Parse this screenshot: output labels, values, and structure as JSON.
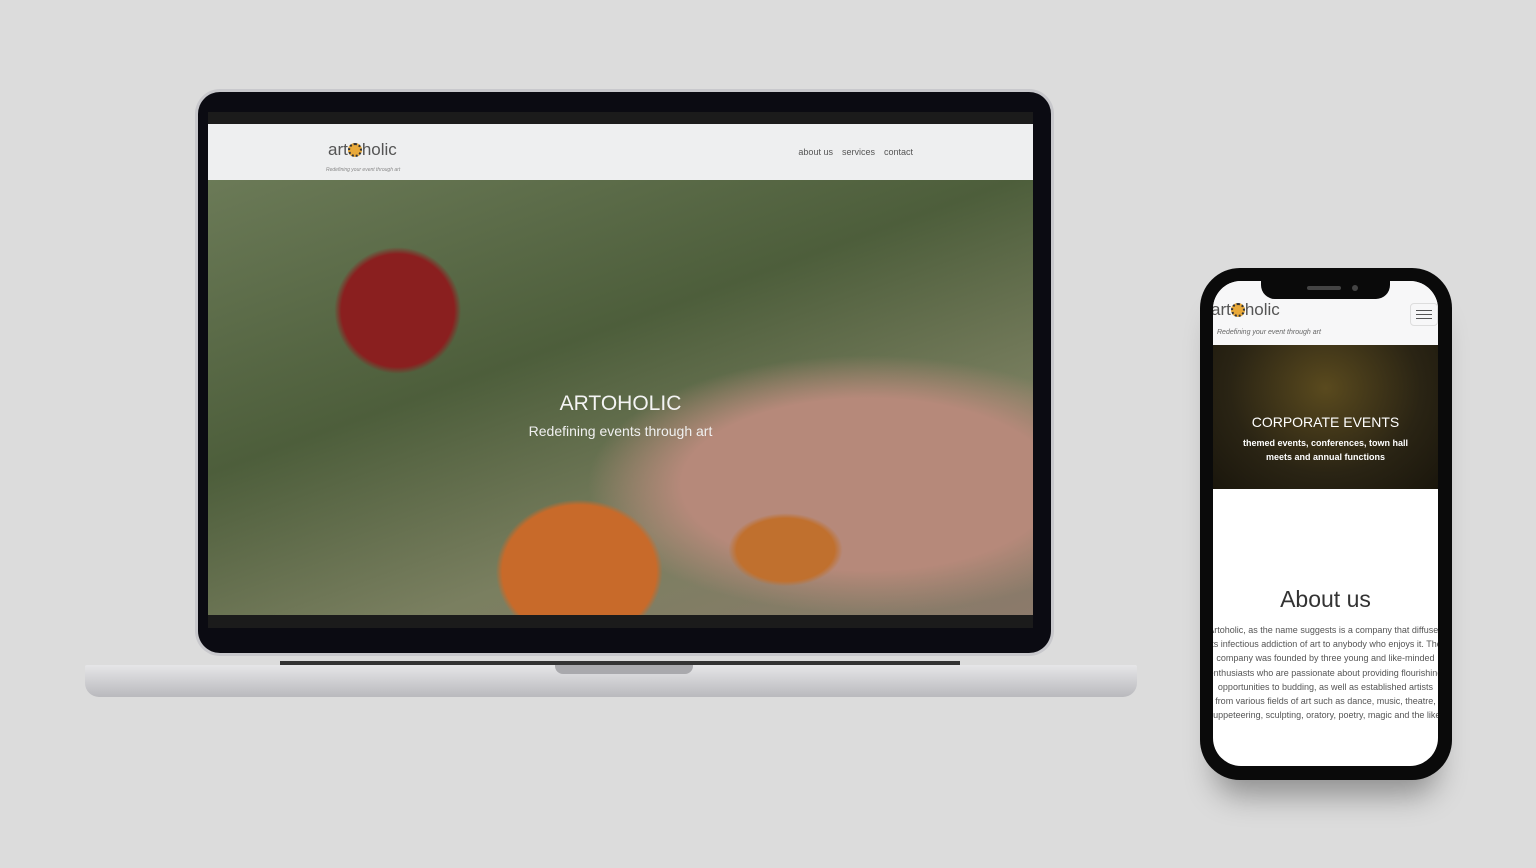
{
  "desktop": {
    "logo": "artoholic",
    "tagline": "Redefining your event through art",
    "nav": [
      "about us",
      "services",
      "contact"
    ],
    "hero": {
      "title": "ARTOHOLIC",
      "subtitle": "Redefining events through art"
    }
  },
  "mobile": {
    "logo": "artoholic",
    "tagline": "Redefining your event through art",
    "hero": {
      "title": "CORPORATE EVENTS",
      "subtitle": "themed events, conferences, town hall meets and annual functions"
    },
    "about": {
      "title": "About us",
      "text": "Artoholic, as the name suggests is a company that diffuses its infectious addiction of art to anybody who enjoys it. The company was founded by three young and like-minded enthusiasts who are passionate about providing flourishing opportunities to budding, as well as established artists from various fields of art such as dance, music, theatre, puppeteering, sculpting, oratory, poetry, magic and the like."
    }
  }
}
